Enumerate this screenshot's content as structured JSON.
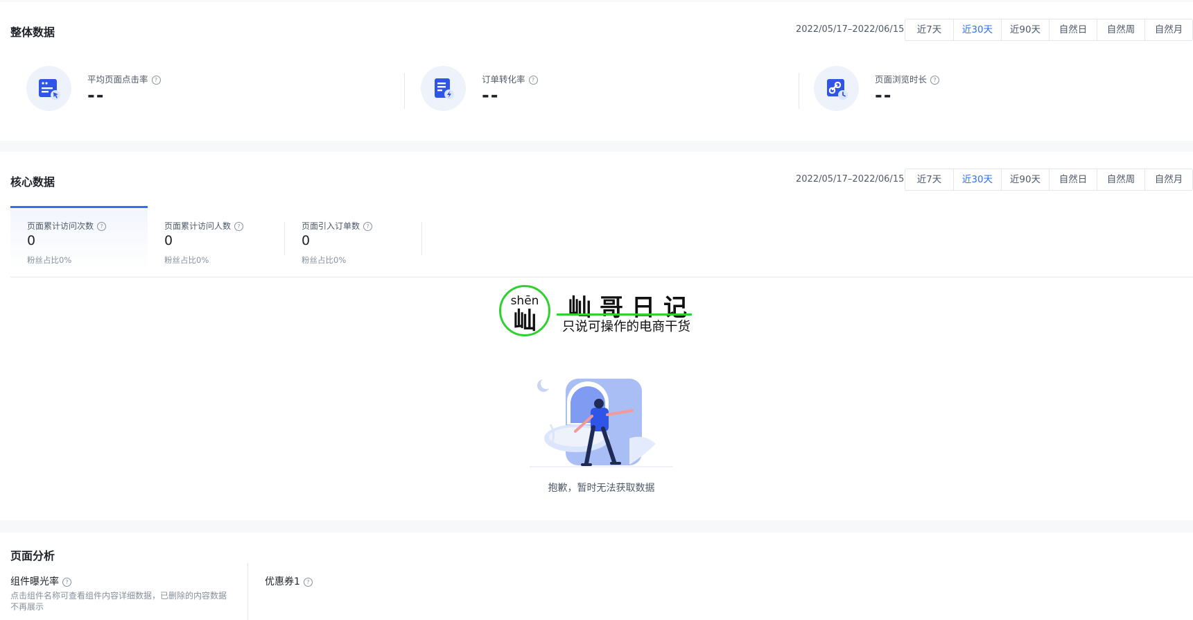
{
  "overall": {
    "title": "整体数据",
    "date_range": "2022/05/17–2022/06/15",
    "range_options": [
      "近7天",
      "近30天",
      "近90天",
      "自然日",
      "自然周",
      "自然月"
    ],
    "active_range": "近30天",
    "metrics": [
      {
        "label": "平均页面点击率",
        "value": "--",
        "icon": "page-click-icon"
      },
      {
        "label": "订单转化率",
        "value": "--",
        "icon": "order-conversion-icon"
      },
      {
        "label": "页面浏览时长",
        "value": "--",
        "icon": "browse-duration-icon"
      }
    ]
  },
  "core": {
    "title": "核心数据",
    "date_range": "2022/05/17–2022/06/15",
    "range_options": [
      "近7天",
      "近30天",
      "近90天",
      "自然日",
      "自然周",
      "自然月"
    ],
    "active_range": "近30天",
    "tabs": [
      {
        "label": "页面累计访问次数",
        "value": "0",
        "sub": "粉丝占比0%"
      },
      {
        "label": "页面累计访问人数",
        "value": "0",
        "sub": "粉丝占比0%"
      },
      {
        "label": "页面引入订单数",
        "value": "0",
        "sub": "粉丝占比0%"
      }
    ],
    "empty_text": "抱歉，暂时无法获取数据"
  },
  "watermark": {
    "pinyin": "shēn",
    "char": "屾",
    "name": "屾哥日记",
    "slogan": "只说可操作的电商干货"
  },
  "page_analysis": {
    "title": "页面分析",
    "exposure_title": "组件曝光率",
    "exposure_desc": "点击组件名称可查看组件内容详细数据，已删除的内容数据不再展示",
    "coupon_title": "优惠券1"
  },
  "colors": {
    "accent": "#2f6ff5",
    "watermark_green": "#2ed12e"
  }
}
